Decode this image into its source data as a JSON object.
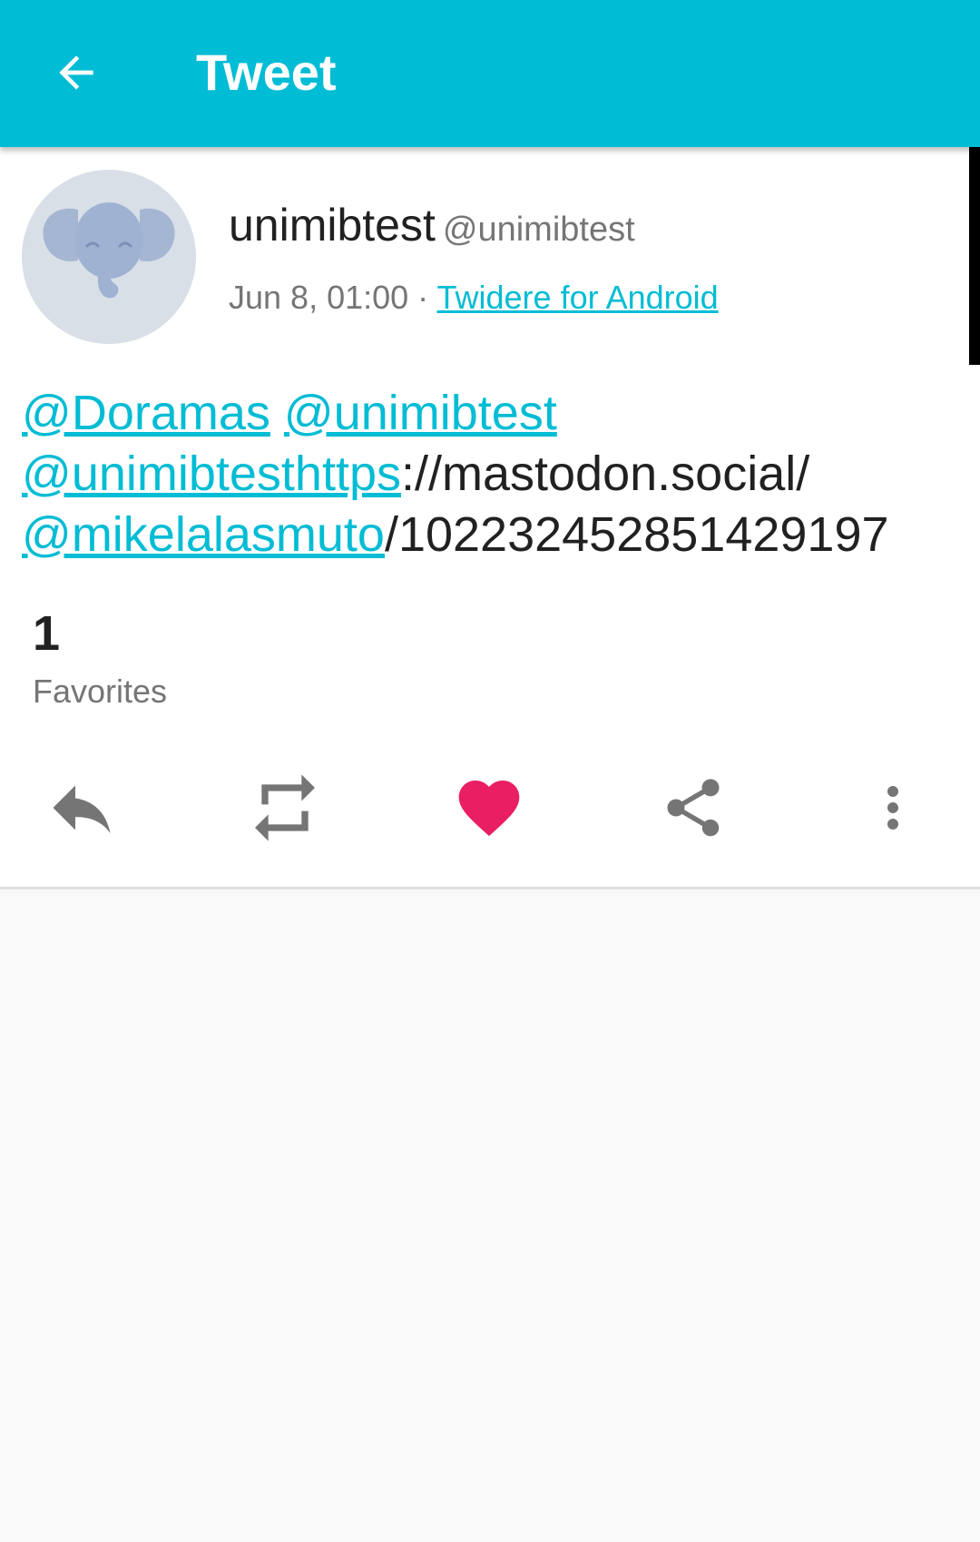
{
  "appbar": {
    "title": "Tweet",
    "back_icon": "arrow-back-icon",
    "background_color": "#00bcd4"
  },
  "status": {
    "user": {
      "display_name": "unimibtest",
      "screen_name": "@unimibtest",
      "avatar_icon": "elephant-avatar"
    },
    "time": "Jun 8, 01:00",
    "separator": " · ",
    "source": "Twidere for Android",
    "text_parts": [
      {
        "text": "@Doramas",
        "link": true
      },
      {
        "text": " ",
        "link": false
      },
      {
        "text": "@unimibtest",
        "link": true
      },
      {
        "text": " ",
        "link": false
      },
      {
        "text": "@unimibtesthttps",
        "link": true
      },
      {
        "text": "://mastodon.social/",
        "link": false
      },
      {
        "text": "@mikelalasmuto",
        "link": true
      },
      {
        "text": "/102232452851429197",
        "link": false
      }
    ],
    "favorites_count": "1",
    "favorites_label": "Favorites"
  },
  "actions": [
    {
      "name": "reply",
      "icon": "reply-icon",
      "color": "#757575"
    },
    {
      "name": "retweet",
      "icon": "retweet-icon",
      "color": "#757575"
    },
    {
      "name": "favorite",
      "icon": "heart-icon",
      "color": "#e91e63"
    },
    {
      "name": "share",
      "icon": "share-icon",
      "color": "#757575"
    },
    {
      "name": "more",
      "icon": "more-vert-icon",
      "color": "#757575"
    }
  ],
  "colors": {
    "accent": "#00bcd4",
    "favorite_active": "#e91e63",
    "icon_gray": "#757575"
  }
}
